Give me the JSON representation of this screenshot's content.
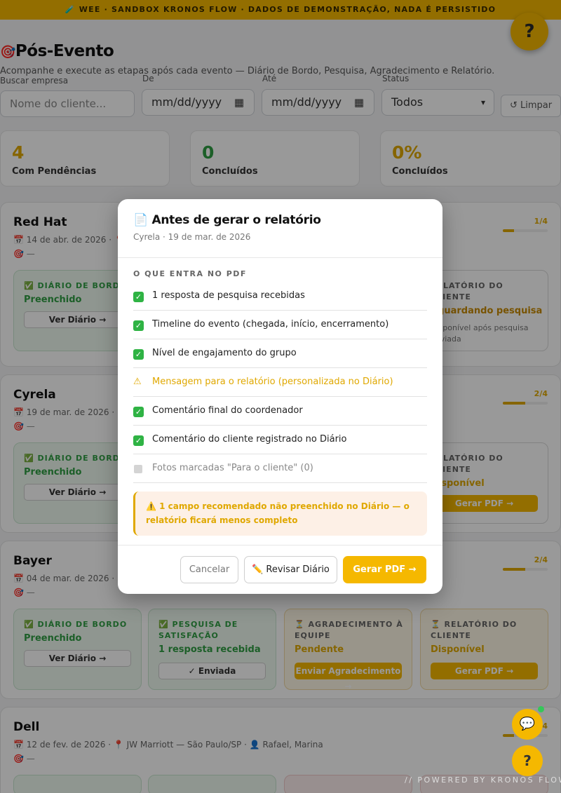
{
  "banner": {
    "text": "🧪 WEE · SANDBOX KRONOS FLOW · DADOS DE DEMONSTRAÇÃO, NADA É PERSISTIDO"
  },
  "help_fab": {
    "label": "?"
  },
  "header": {
    "icon": "🎯",
    "title": "Pós-Evento",
    "subtitle": "Acompanhe e execute as etapas após cada evento — Diário de Bordo, Pesquisa, Agradecimento e Relatório."
  },
  "filters": {
    "company_label": "Buscar empresa",
    "company_placeholder": "Nome do cliente...",
    "from_label": "De",
    "from_value": "mm/dd/yyyy",
    "to_label": "Até",
    "to_value": "mm/dd/yyyy",
    "status_label": "Status",
    "status_value": "Todos",
    "clear_label": "↺ Limpar"
  },
  "stats": [
    {
      "value": "4",
      "label": "Com Pendências"
    },
    {
      "value": "0",
      "label": "Concluídos"
    },
    {
      "value": "0%",
      "label": "Concluídos"
    }
  ],
  "events": [
    {
      "name": "Red Hat",
      "meta": "📅 14 de abr. de 2026 · 📍 G",
      "meta2": "🎯 —",
      "progress": "1/4",
      "progress_frac": 0.25,
      "steps": [
        {
          "title": "✅ DIÁRIO DE BORDO",
          "status": "Preenchido",
          "button": "Ver Diário →"
        },
        {
          "title": "RELATÓRIO DO CLIENTE",
          "status": "Aguardando pesquisa",
          "note": "Disponível após pesquisa enviada"
        }
      ]
    },
    {
      "name": "Cyrela",
      "meta": "📅 19 de mar. de 2026 · 📍 T",
      "meta2": "🎯 —",
      "progress": "2/4",
      "progress_frac": 0.5,
      "steps": [
        {
          "title": "✅ DIÁRIO DE BORDO",
          "status": "Preenchido",
          "button": "Ver Diário →"
        },
        {
          "title": "RELATÓRIO DO CLIENTE",
          "status": "Disponível",
          "button": "Gerar PDF →"
        }
      ]
    },
    {
      "name": "Bayer",
      "meta": "📅 04 de mar. de 2026 · 📍 T",
      "meta2": "🎯 —",
      "progress": "2/4",
      "progress_frac": 0.5,
      "steps": [
        {
          "title": "✅ DIÁRIO DE BORDO",
          "status": "Preenchido",
          "button": "Ver Diário →"
        },
        {
          "title": "✅ PESQUISA DE SATISFAÇÃO",
          "status": "1 resposta recebida",
          "button": "✓ Enviada"
        },
        {
          "title": "⏳ AGRADECIMENTO À EQUIPE",
          "status": "Pendente",
          "button": "Enviar Agradecimento →"
        },
        {
          "title": "⏳ RELATÓRIO DO CLIENTE",
          "status": "Disponível",
          "button": "Gerar PDF →"
        }
      ]
    },
    {
      "name": "Dell",
      "meta": "📅 12 de fev. de 2026 · 📍 JW Marriott — São Paulo/SP · 👤 Rafael, Marina",
      "meta2": "🎯 —",
      "progress": "1/4",
      "progress_frac": 0.25
    }
  ],
  "modal": {
    "icon": "📄",
    "title": "Antes de gerar o relatório",
    "subtitle": "Cyrela · 19 de mar. de 2026",
    "section_label": "O QUE ENTRA NO PDF",
    "items": [
      {
        "state": "ok",
        "text": "1 resposta de pesquisa recebidas"
      },
      {
        "state": "ok",
        "text": "Timeline do evento (chegada, início, encerramento)"
      },
      {
        "state": "ok",
        "text": "Nível de engajamento do grupo"
      },
      {
        "state": "warn",
        "text": "Mensagem para o relatório (personalizada no Diário)"
      },
      {
        "state": "ok",
        "text": "Comentário final do coordenador"
      },
      {
        "state": "ok",
        "text": "Comentário do cliente registrado no Diário"
      },
      {
        "state": "off",
        "text": "Fotos marcadas \"Para o cliente\" (0)"
      }
    ],
    "alert": "⚠️ 1 campo recomendado não preenchido no Diário — o relatório ficará menos completo",
    "cancel": "Cancelar",
    "review": "✏️ Revisar Diário",
    "generate": "Gerar PDF →"
  },
  "footer": {
    "powered": "// POWERED BY KRONOS FLOW",
    "chat_icon": "chat-icon",
    "help_label": "?"
  },
  "colors": {
    "accent": "#f5b800",
    "success": "#2fb344",
    "warning": "#e0a800"
  }
}
